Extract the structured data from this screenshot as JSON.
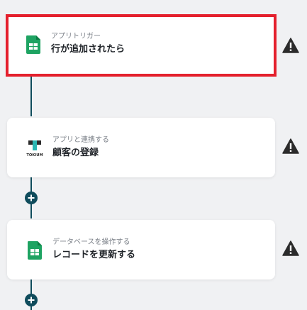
{
  "flow": {
    "steps": [
      {
        "subtitle": "アプリトリガー",
        "title": "行が追加されたら",
        "icon": "google-sheets-icon",
        "selected": true
      },
      {
        "subtitle": "アプリと連携する",
        "title": "顧客の登録",
        "icon": "tokium-logo-icon",
        "logo_text": "TOKIUM"
      },
      {
        "subtitle": "データベースを操作する",
        "title": "レコードを更新する",
        "icon": "google-sheets-icon"
      }
    ],
    "add_button_icon": "plus-icon",
    "warning_icon": "warning-icon"
  },
  "colors": {
    "accent": "#0f4c5c",
    "selected_border": "#e4202d",
    "sheets_green": "#1ea362",
    "tokium_teal": "#2bb7b3"
  }
}
